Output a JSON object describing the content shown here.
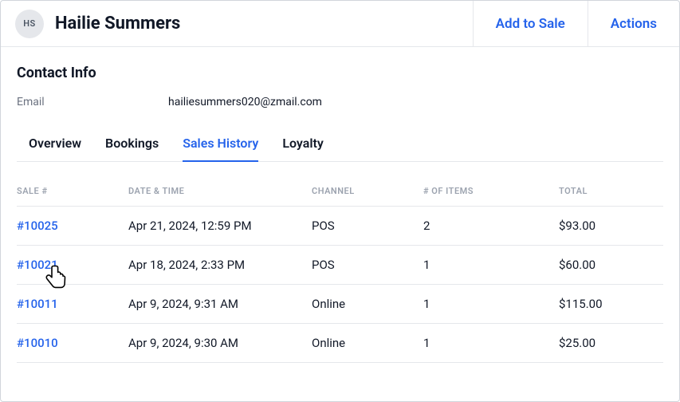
{
  "header": {
    "avatar_initials": "HS",
    "customer_name": "Hailie Summers",
    "add_to_sale_label": "Add to Sale",
    "actions_label": "Actions"
  },
  "contact": {
    "section_title": "Contact Info",
    "email_label": "Email",
    "email_value": "hailiesummers020@zmail.com"
  },
  "tabs": {
    "overview": "Overview",
    "bookings": "Bookings",
    "sales_history": "Sales History",
    "loyalty": "Loyalty"
  },
  "table": {
    "headers": {
      "sale": "SALE #",
      "datetime": "DATE & TIME",
      "channel": "CHANNEL",
      "items": "# OF ITEMS",
      "total": "TOTAL"
    },
    "rows": [
      {
        "sale": "#10025",
        "datetime": "Apr 21, 2024, 12:59 PM",
        "channel": "POS",
        "items": "2",
        "total": "$93.00"
      },
      {
        "sale": "#10021",
        "datetime": "Apr 18, 2024, 2:33 PM",
        "channel": "POS",
        "items": "1",
        "total": "$60.00"
      },
      {
        "sale": "#10011",
        "datetime": "Apr 9, 2024, 9:31 AM",
        "channel": "Online",
        "items": "1",
        "total": "$115.00"
      },
      {
        "sale": "#10010",
        "datetime": "Apr 9, 2024, 9:30 AM",
        "channel": "Online",
        "items": "1",
        "total": "$25.00"
      }
    ]
  }
}
